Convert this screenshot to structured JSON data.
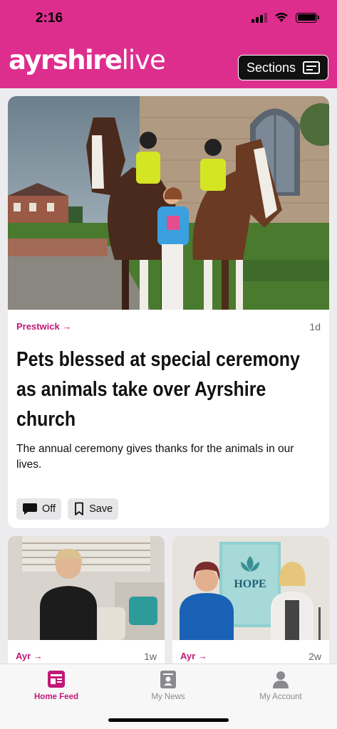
{
  "status_bar": {
    "time": "2:16"
  },
  "header": {
    "brand_bold": "ayrshire",
    "brand_light": "live",
    "sections_label": "Sections",
    "brand_color": "#dd2e8e"
  },
  "main_article": {
    "section": "Prestwick",
    "age": "1d",
    "headline": "Pets blessed at special ceremony as animals take over Ayrshire church",
    "summary": "The annual ceremony gives thanks for the animals in our lives.",
    "comments_label": "Off",
    "save_label": "Save"
  },
  "small_articles": [
    {
      "section": "Ayr",
      "age": "1w"
    },
    {
      "section": "Ayr",
      "age": "2w",
      "sign_title": "HOPE"
    }
  ],
  "tabs": [
    {
      "label": "Home Feed",
      "icon": "home-feed-icon",
      "active": true
    },
    {
      "label": "My News",
      "icon": "my-news-icon",
      "active": false
    },
    {
      "label": "My Account",
      "icon": "account-icon",
      "active": false
    }
  ],
  "accent_color": "#c21877"
}
